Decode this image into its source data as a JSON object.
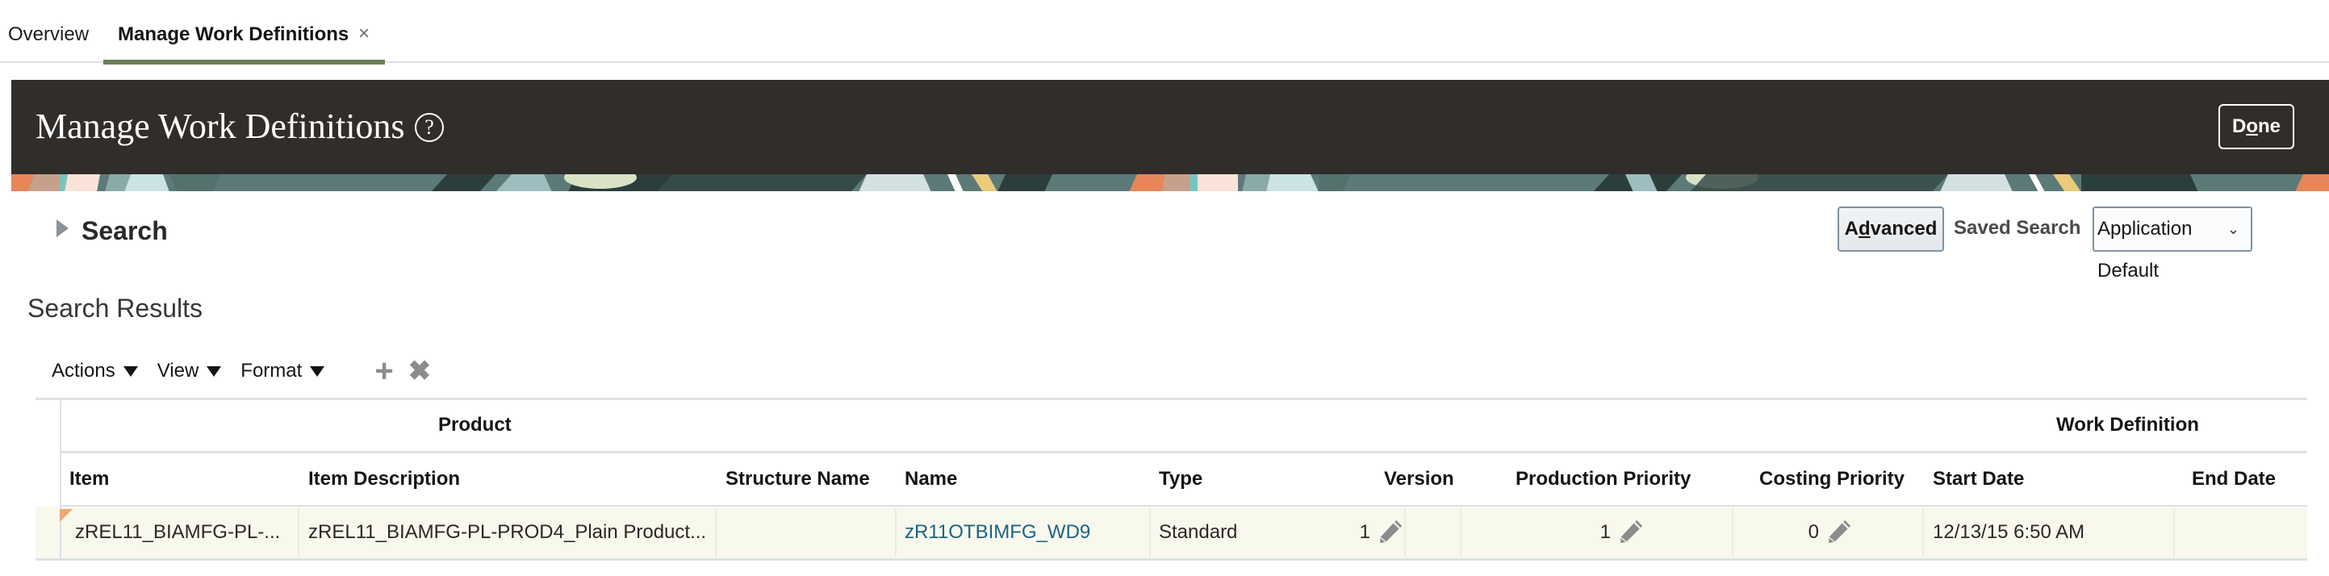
{
  "tabs": [
    {
      "label": "Overview",
      "active": false
    },
    {
      "label": "Manage Work Definitions",
      "active": true,
      "closable": true
    }
  ],
  "tab_close_icon": "×",
  "header": {
    "title": "Manage Work Definitions",
    "help_icon": "?",
    "done_label_pre": "D",
    "done_label_mnemonic": "o",
    "done_label_post": "ne",
    "background_color": "#312d2a"
  },
  "search": {
    "label": "Search",
    "expanded": false,
    "advanced_pre": "A",
    "advanced_mnemonic": "d",
    "advanced_post": "vanced",
    "saved_search_label": "Saved Search",
    "saved_search_value": "Application Default",
    "chevron": "⌄"
  },
  "results": {
    "title": "Search Results",
    "toolbar": {
      "menus": [
        "Actions",
        "View",
        "Format"
      ],
      "add_icon": "+",
      "delete_icon": "✖"
    },
    "column_groups": [
      "Product",
      "Work Definition"
    ],
    "columns": [
      "Item",
      "Item Description",
      "Structure Name",
      "Name",
      "Type",
      "Version",
      "Production Priority",
      "Costing Priority",
      "Start Date",
      "End Date"
    ],
    "rows": [
      {
        "item": "zREL11_BIAMFG-PL-...",
        "item_description": "zREL11_BIAMFG-PL-PROD4_Plain Product...",
        "structure_name": "",
        "name": "zR11OTBIMFG_WD9",
        "type": "Standard",
        "version": "1",
        "production_priority": "1",
        "costing_priority": "0",
        "start_date": "12/13/15 6:50 AM",
        "end_date": "",
        "selected": true
      }
    ]
  },
  "colors": {
    "tab_underline": "#6b8157",
    "link": "#1b6383",
    "selected_row": "#f8f8ed",
    "row_flag": "#f0a775"
  }
}
